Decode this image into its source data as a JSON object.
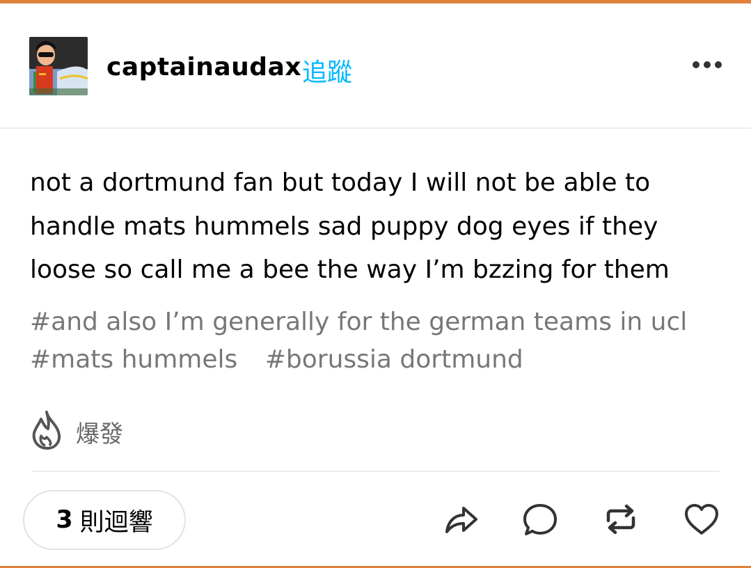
{
  "colors": {
    "accent_top": "#e0823a",
    "follow_blue": "#00b8ff",
    "tag_gray": "#777777",
    "divider": "#ececec"
  },
  "header": {
    "username": "captainaudax",
    "follow_label": "追蹤",
    "more_icon": "ellipsis-icon"
  },
  "post": {
    "text": "not a dortmund fan but today I will not be able to handle mats hummels sad puppy dog eyes if they loose so call me a bee the way I’m bzzing for them",
    "tags": [
      "#and also I’m generally for the german teams in ucl",
      "#mats hummels",
      "#borussia dortmund"
    ]
  },
  "notes": {
    "icon": "flame-icon",
    "label": "爆發"
  },
  "footer": {
    "reply_count": "3",
    "reply_label": "則迴響",
    "actions": [
      "share-icon",
      "comment-icon",
      "reblog-icon",
      "heart-icon"
    ]
  }
}
